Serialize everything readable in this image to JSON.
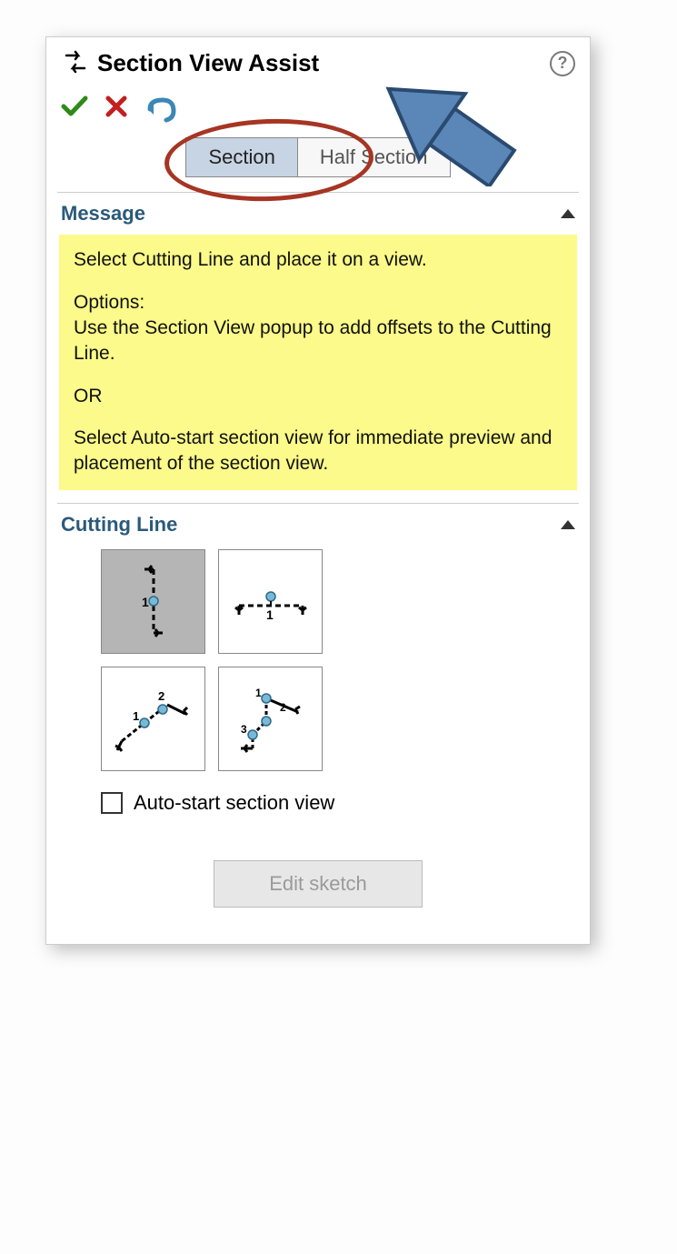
{
  "header": {
    "title": "Section View Assist"
  },
  "tabs": {
    "section": "Section",
    "half_section": "Half Section"
  },
  "groups": {
    "message_label": "Message",
    "cutting_line_label": "Cutting Line"
  },
  "message": {
    "l1": "Select Cutting Line and place it on a view.",
    "l2": "Options:",
    "l3": "Use the Section View popup to add offsets to the Cutting Line.",
    "l4": "OR",
    "l5": "Select Auto-start section view for immediate preview and placement of the section view."
  },
  "options": {
    "auto_start_label": "Auto-start section view"
  },
  "buttons": {
    "edit_sketch": "Edit sketch"
  }
}
